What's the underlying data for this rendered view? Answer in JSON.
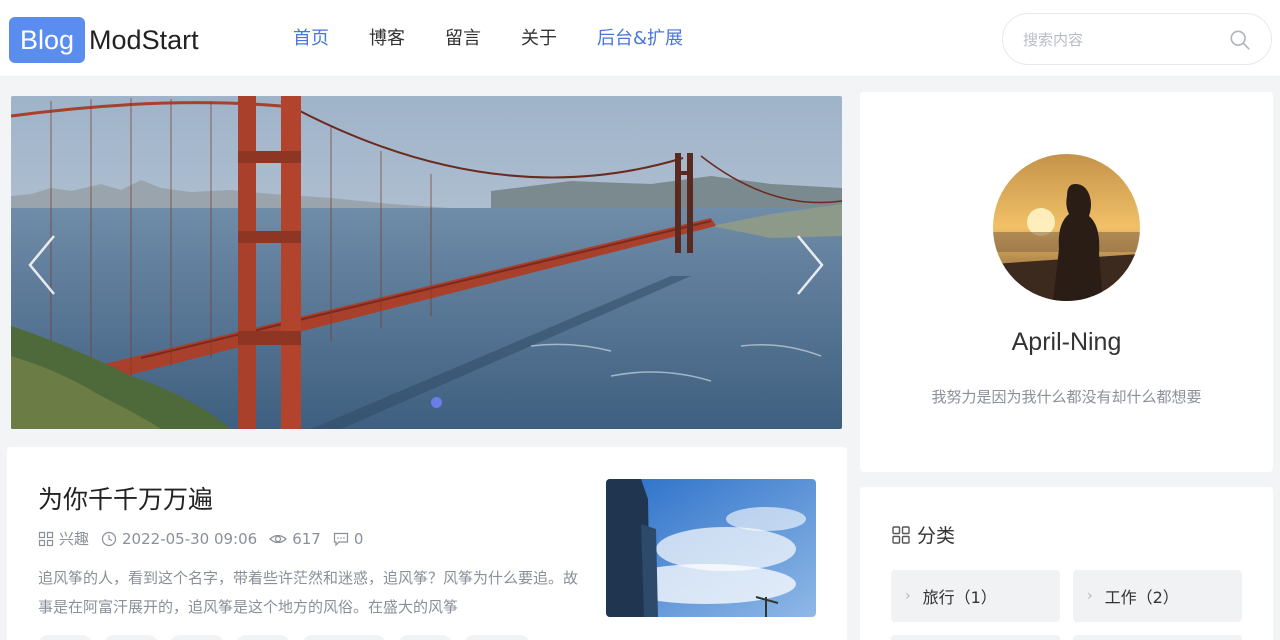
{
  "header": {
    "logo_badge": "Blog",
    "logo_text": "ModStart",
    "nav": [
      "首页",
      "博客",
      "留言",
      "关于",
      "后台&扩展"
    ],
    "search_placeholder": "搜索内容"
  },
  "colors": {
    "accent": "#4a76d9",
    "logo_badge_bg": "#5b8def",
    "carousel_dot": "#6a7de8",
    "page_bg": "#f3f4f6"
  },
  "banner": {
    "prev_icon": "chevron-left-icon",
    "next_icon": "chevron-right-icon"
  },
  "article": {
    "title": "为你千千万万遍",
    "category": "兴趣",
    "date": "2022-05-30 09:06",
    "views": "617",
    "comments": "0",
    "excerpt": "追风筝的人，看到这个名字，带着些许茫然和迷惑，追风筝？风筝为什么要追。故事是在阿富汗展开的，追风筝是这个地方的风俗。在盛大的风筝"
  },
  "profile": {
    "name": "April-Ning",
    "bio": "我努力是因为我什么都没有却什么都想要"
  },
  "category": {
    "title": "分类",
    "items": [
      {
        "label": "旅行（1）"
      },
      {
        "label": "工作（2）"
      }
    ]
  }
}
